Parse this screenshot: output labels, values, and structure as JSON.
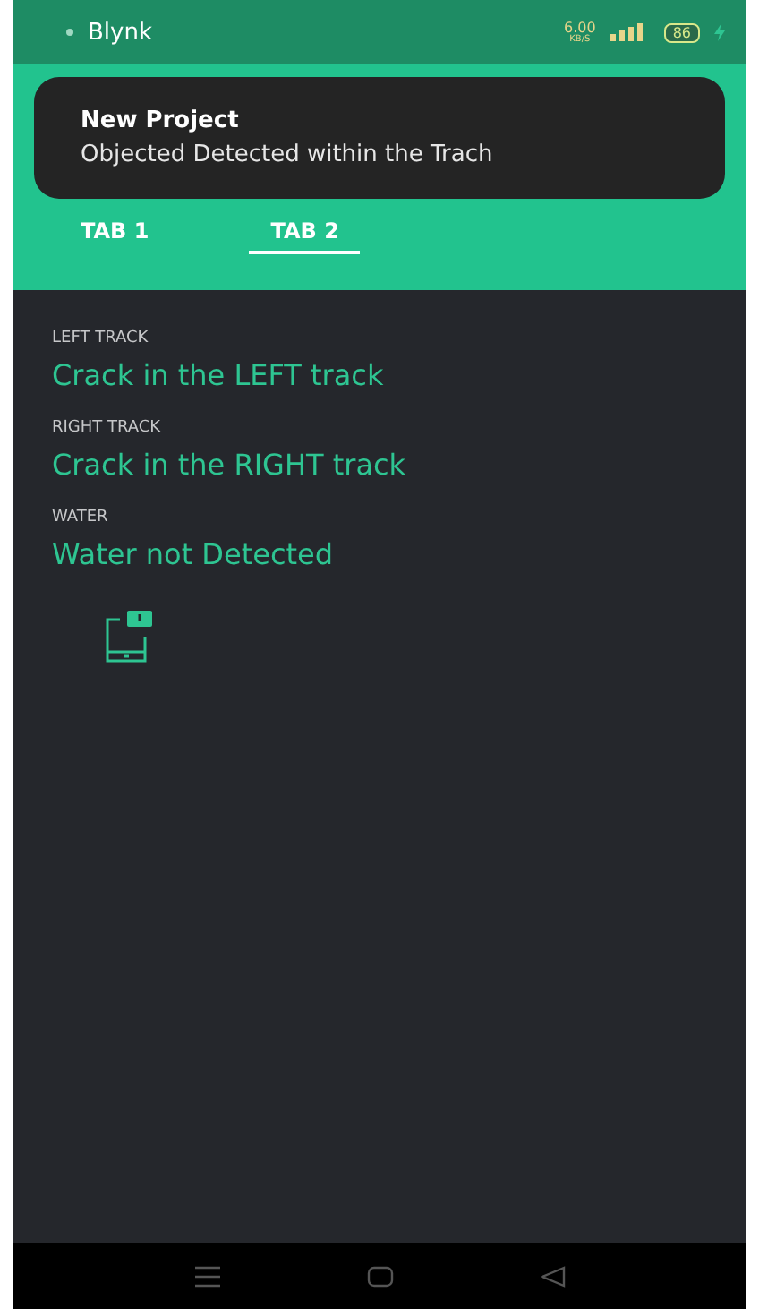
{
  "status_bar": {
    "app": "Blynk",
    "speed": "6.00",
    "speed_unit": "KB/S",
    "battery": "86",
    "charging": true
  },
  "notification": {
    "title": "New Project",
    "message": "Objected Detected within the Trach"
  },
  "tabs": [
    {
      "label": "TAB 1",
      "selected": false
    },
    {
      "label": "TAB 2",
      "selected": true
    }
  ],
  "widgets": [
    {
      "kind": "label",
      "label": "LEFT TRACK",
      "value": "Crack in the LEFT track"
    },
    {
      "kind": "label",
      "label": "RIGHT TRACK",
      "value": "Crack in the RIGHT track"
    },
    {
      "kind": "label",
      "label": "WATER",
      "value": "Water not Detected"
    },
    {
      "kind": "notify"
    }
  ]
}
